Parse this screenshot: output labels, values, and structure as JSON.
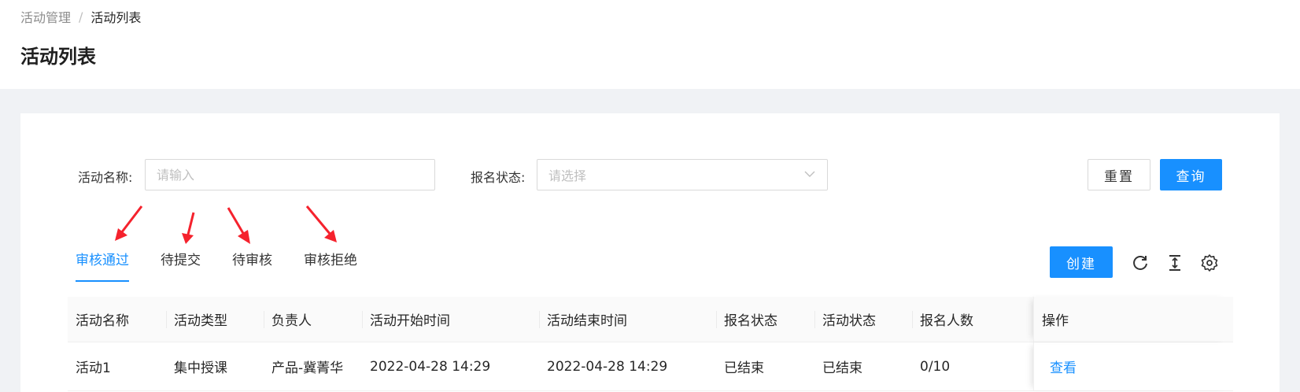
{
  "breadcrumb": {
    "parent": "活动管理",
    "separator": "/",
    "current": "活动列表"
  },
  "page_title": "活动列表",
  "filters": {
    "name_label": "活动名称:",
    "name_placeholder": "请输入",
    "status_label": "报名状态:",
    "status_placeholder": "请选择"
  },
  "buttons": {
    "reset": "重置",
    "query": "查询",
    "create": "创建"
  },
  "tabs": [
    "审核通过",
    "待提交",
    "待审核",
    "审核拒绝"
  ],
  "toolbar_icons": [
    "refresh-icon",
    "column-height-icon",
    "settings-icon"
  ],
  "table": {
    "headers": [
      "活动名称",
      "活动类型",
      "负责人",
      "活动开始时间",
      "活动结束时间",
      "报名状态",
      "活动状态",
      "报名人数",
      "操作"
    ],
    "rows": [
      [
        "活动1",
        "集中授课",
        "产品-冀菁华",
        "2022-04-28 14:29",
        "2022-04-28 14:29",
        "已结束",
        "已结束",
        "0/10",
        "查看"
      ]
    ]
  },
  "colors": {
    "primary": "#1890ff",
    "annotation_arrow": "#f5222d"
  }
}
